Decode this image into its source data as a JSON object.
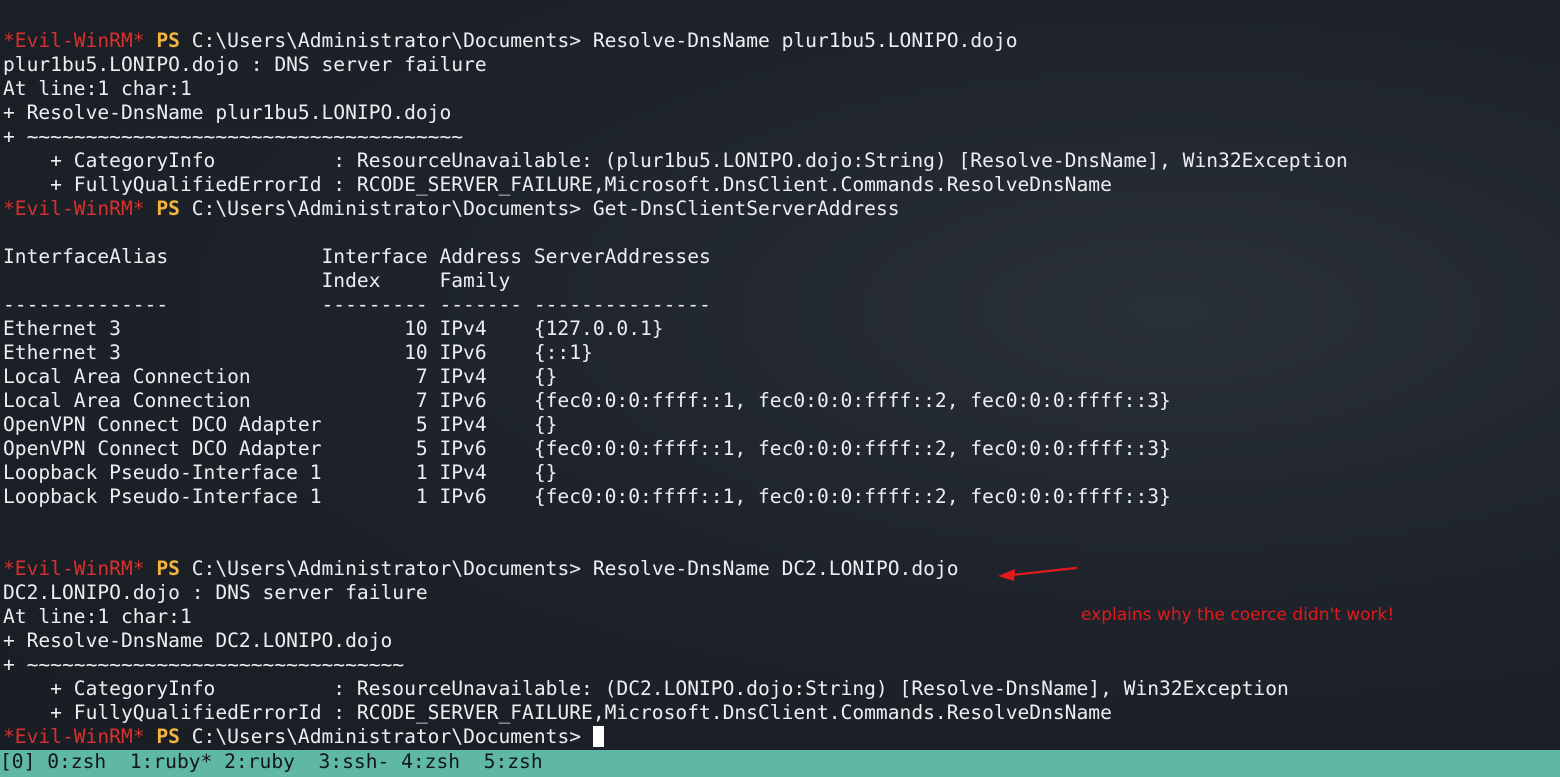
{
  "prompt": {
    "marker": "*Evil-WinRM*",
    "ps": "PS",
    "path": "C:\\Users\\Administrator\\Documents>"
  },
  "commands": {
    "cmd1": "Resolve-DnsName plur1bu5.LONIPO.dojo",
    "cmd2": "Get-DnsClientServerAddress",
    "cmd3": "Resolve-DnsName DC2.LONIPO.dojo",
    "cmd4": ""
  },
  "error1": {
    "line1": "plur1bu5.LONIPO.dojo : DNS server failure",
    "line2": "At line:1 char:1",
    "line3": "+ Resolve-DnsName plur1bu5.LONIPO.dojo",
    "line4": "+ ~~~~~~~~~~~~~~~~~~~~~~~~~~~~~~~~~~~~~",
    "line5": "    + CategoryInfo          : ResourceUnavailable: (plur1bu5.LONIPO.dojo:String) [Resolve-DnsName], Win32Exception",
    "line6": "    + FullyQualifiedErrorId : RCODE_SERVER_FAILURE,Microsoft.DnsClient.Commands.ResolveDnsName"
  },
  "table": {
    "header1": "InterfaceAlias             Interface Address ServerAddresses",
    "header2": "                           Index     Family",
    "underline": "--------------             --------- ------- ---------------",
    "rows": [
      "Ethernet 3                        10 IPv4    {127.0.0.1}",
      "Ethernet 3                        10 IPv6    {::1}",
      "Local Area Connection              7 IPv4    {}",
      "Local Area Connection              7 IPv6    {fec0:0:0:ffff::1, fec0:0:0:ffff::2, fec0:0:0:ffff::3}",
      "OpenVPN Connect DCO Adapter        5 IPv4    {}",
      "OpenVPN Connect DCO Adapter        5 IPv6    {fec0:0:0:ffff::1, fec0:0:0:ffff::2, fec0:0:0:ffff::3}",
      "Loopback Pseudo-Interface 1        1 IPv4    {}",
      "Loopback Pseudo-Interface 1        1 IPv6    {fec0:0:0:ffff::1, fec0:0:0:ffff::2, fec0:0:0:ffff::3}"
    ]
  },
  "error2": {
    "line1": "DC2.LONIPO.dojo : DNS server failure",
    "line2": "At line:1 char:1",
    "line3": "+ Resolve-DnsName DC2.LONIPO.dojo",
    "line4": "+ ~~~~~~~~~~~~~~~~~~~~~~~~~~~~~~~~",
    "line5": "    + CategoryInfo          : ResourceUnavailable: (DC2.LONIPO.dojo:String) [Resolve-DnsName], Win32Exception",
    "line6": "    + FullyQualifiedErrorId : RCODE_SERVER_FAILURE,Microsoft.DnsClient.Commands.ResolveDnsName"
  },
  "annotation": {
    "text": "explains why the coerce didn't work!",
    "color": "#e21a1a"
  },
  "statusbar": {
    "session": "[0]",
    "windows": [
      "0:zsh",
      "1:ruby*",
      "2:ruby",
      "3:ssh-",
      "4:zsh",
      "5:zsh"
    ],
    "color": "#5fb8a5"
  },
  "colors": {
    "background": "#1c2129",
    "evil_marker": "#d6312c",
    "ps_label": "#f2b43a",
    "text": "#eceff2"
  }
}
